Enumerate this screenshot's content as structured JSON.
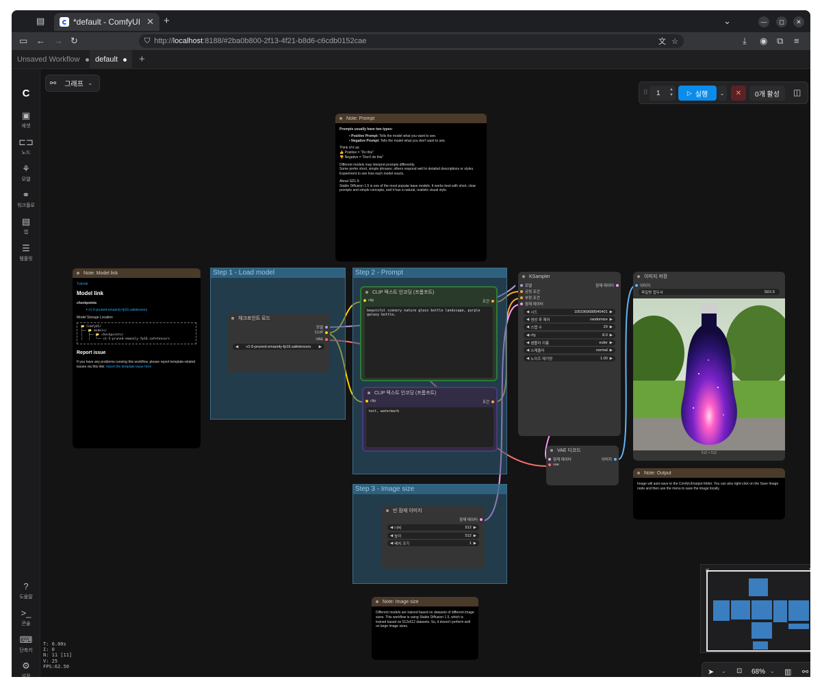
{
  "browser": {
    "tab_title": "*default - ComfyUI",
    "url_scheme": "http://",
    "url_host": "localhost",
    "url_rest": ":8188/#2ba0b800-2f13-4f21-b8d6-c6cdb0152cae"
  },
  "workflow_tabs": [
    {
      "label": "Unsaved Workflow"
    },
    {
      "label": "default"
    }
  ],
  "toolbar": {
    "graph_label": "그래프",
    "batch_count": "1",
    "run_label": "실행",
    "active_label": "0개 활성"
  },
  "sidebar": {
    "items": [
      {
        "label": "에셋"
      },
      {
        "label": "노드"
      },
      {
        "label": "모델"
      },
      {
        "label": "워크플로"
      },
      {
        "label": "앱"
      },
      {
        "label": "템플릿"
      }
    ],
    "bottom": [
      {
        "label": "도움말"
      },
      {
        "label": "콘솔"
      },
      {
        "label": "단축키"
      },
      {
        "label": "설정"
      }
    ]
  },
  "stats": {
    "t": "T: 0.00s",
    "i": "I: 0",
    "n": "N: 11 [11]",
    "v": "V: 25",
    "fps": "FPS:62.50"
  },
  "zoom": "68%",
  "groups": {
    "step1": "Step 1 - Load model",
    "step2": "Step 2 - Prompt",
    "step3": "Step 3 - Image size"
  },
  "note_prompt": {
    "title": "Note: Prompt",
    "line1": "Prompts usually have two types:",
    "pos_label": "Positive Prompt:",
    "pos_text": " Tells the model what you want to see.",
    "neg_label": "Negative Prompt:",
    "neg_text": " Tells the model what you don't want to see.",
    "think": "Think of it as:",
    "think_pos": "👍 Positive = \"Do this\"",
    "think_neg": "👎 Negative = \"Don't do this\"",
    "diff1": "Different models may interpret prompts differently.",
    "diff2": "Some prefer short, simple phrases; others respond well to detailed descriptions or styles.",
    "diff3": "Experiment to see how each model reacts.",
    "about": "About SD1.5:",
    "about_text": "Stable Diffusion 1.5 is one of the most popular base models. It works best with short, clear prompts and simple concepts, and it has a natural, realistic visual style."
  },
  "note_model": {
    "title": "Note: Model link",
    "tutorial": "Tutorial",
    "heading": "Model link",
    "checkpoints": "checkpoints",
    "ckpt_link": "v1-5-pruned-emaonly-fp16.safetensors",
    "storage": "Model Storage Location",
    "tree1": "📂 ComfyUI/",
    "tree2": "├── 📂 models/",
    "tree3": "│   ├── 📂 checkpoints/",
    "tree4": "│   │   └── v1-5-pruned-emaonly-fp16.safetensors",
    "report_heading": "Report issue",
    "report_text": "If you have any problems running this workflow, please report template-related issues via this link:",
    "report_link": "report the template issue here"
  },
  "ckpt_loader": {
    "title": "체크포인트 로드",
    "out_model": "모델",
    "out_clip": "CLIP",
    "out_vae": "VAE",
    "ckpt_value": "v1-5-pruned-emaonly-fp16.safetensors"
  },
  "clip_pos": {
    "title": "CLIP 텍스트 인코딩 (프롬프트)",
    "in_clip": "clip",
    "out": "조건",
    "text": "beautiful scenery nature glass bottle landscape, purple galaxy bottle,"
  },
  "clip_neg": {
    "title": "CLIP 텍스트 인코딩 (프롬프트)",
    "in_clip": "clip",
    "out": "조건",
    "text": "text, watermark"
  },
  "ksampler": {
    "title": "KSampler",
    "in_model": "모델",
    "in_pos": "긍정 조건",
    "in_neg": "부정 조건",
    "in_latent": "잠재 데이터",
    "out_latent": "잠재 데이터",
    "w_seed_label": "시드",
    "w_seed": "1001969688945401",
    "w_ctrl_label": "생성 후 제어",
    "w_ctrl": "randomize",
    "w_steps_label": "스텝 수",
    "w_steps": "20",
    "w_cfg_label": "cfg",
    "w_cfg": "8.0",
    "w_sampler_label": "샘플러 이름",
    "w_sampler": "euler",
    "w_sched_label": "스케줄러",
    "w_sched": "normal",
    "w_denoise_label": "노이즈 제거양",
    "w_denoise": "1.00"
  },
  "latent": {
    "title": "빈 잠재 이미지",
    "out": "잠재 데이터",
    "w_width_label": "너비",
    "w_width": "512",
    "w_height_label": "높이",
    "w_height": "512",
    "w_batch_label": "배치 크기",
    "w_batch": "1"
  },
  "vae_decode": {
    "title": "VAE 디코드",
    "in_samples": "잠재 데이터",
    "in_vae": "vae",
    "out": "이미지"
  },
  "save_image": {
    "title": "이미지 저장",
    "in_images": "이미지",
    "prefix_label": "파일명 접두사",
    "prefix": "SD1.5",
    "caption": "512 × 512"
  },
  "note_output": {
    "title": "Note: Output",
    "text": "Image will auto-save to the ComfyUI/output folder. You can also right-click on the Save Image node and then use the menu to save the image locally."
  },
  "note_size": {
    "title": "Note: Image size",
    "text": "Different models are trained based on datasets of different image sizes. This workflow is using Stable Diffusion 1.5, which is trained based on 512x512 datasets. So, it doesn't perform well on large image sizes."
  },
  "colors": {
    "accent": "#0b8ce9",
    "group": "#2e5c7a",
    "note_header": "#4a3a2a",
    "clip_pos_border": "#2e7a3a",
    "clip_neg_border": "#4a3a7a",
    "wire_model": "#b39ddb",
    "wire_clip": "#ffd500",
    "wire_vae": "#ff6e6e",
    "wire_cond": "#ffa931",
    "wire_latent": "#ff9cf9",
    "wire_image": "#64b5f6"
  }
}
